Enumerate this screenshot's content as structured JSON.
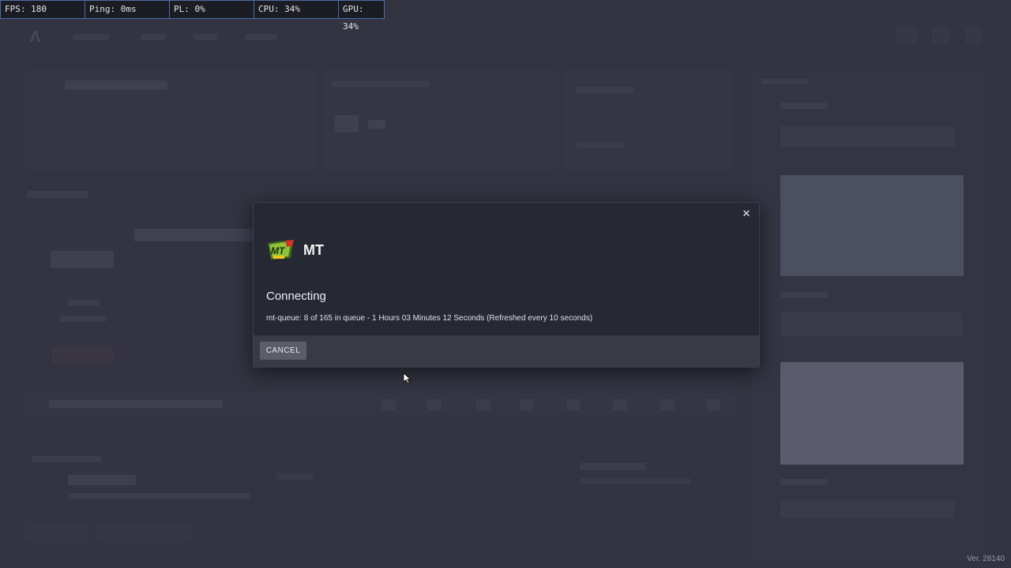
{
  "stats": [
    {
      "label": "FPS: 180"
    },
    {
      "label": "Ping: 0ms"
    },
    {
      "label": "PL: 0%"
    },
    {
      "label": "CPU: 34%"
    },
    {
      "label": "GPU: 34%"
    }
  ],
  "modal": {
    "server_name": "MT",
    "server_logo_text": "MT",
    "status_title": "Connecting",
    "queue_message": "mt-queue: 8 of 165 in queue - 1 Hours 03 Minutes 12 Seconds (Refreshed every 10 seconds)",
    "cancel_label": "CANCEL",
    "close_icon": "close-icon"
  },
  "version": "Ver. 28140"
}
